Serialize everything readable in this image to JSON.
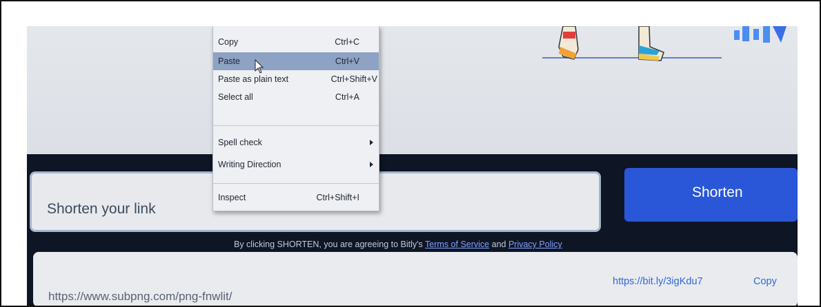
{
  "context_menu": {
    "items": [
      {
        "label": "Copy",
        "shortcut": "Ctrl+C"
      },
      {
        "label": "Paste",
        "shortcut": "Ctrl+V"
      },
      {
        "label": "Paste as plain text",
        "shortcut": "Ctrl+Shift+V"
      },
      {
        "label": "Select all",
        "shortcut": "Ctrl+A"
      },
      {
        "label": "Spell check",
        "shortcut": ""
      },
      {
        "label": "Writing Direction",
        "shortcut": ""
      },
      {
        "label": "Inspect",
        "shortcut": "Ctrl+Shift+I"
      }
    ],
    "highlighted": "Paste"
  },
  "shortener": {
    "input_placeholder": "Shorten your link",
    "button_label": "Shorten",
    "disclaimer_prefix": "By clicking SHORTEN, you are agreeing to Bitly's ",
    "terms_link": "Terms of Service",
    "disclaimer_and": " and ",
    "privacy_link": "Privacy Policy"
  },
  "result": {
    "long_url": "https://www.subpng.com/png-fnwlit/",
    "short_url": "https://bit.ly/3igKdu7",
    "copy_label": "Copy"
  },
  "colors": {
    "accent": "#2a56d8",
    "menu_highlight": "#8ea2c4",
    "link": "#2f68d6"
  }
}
